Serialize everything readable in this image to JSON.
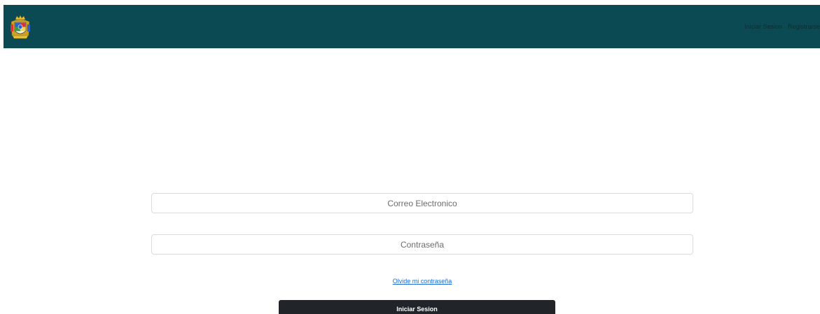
{
  "navbar": {
    "background_color": "#0b4a52",
    "logo_icon": "coat-of-arms-logo",
    "links": [
      {
        "label": "Iniciar Sesion"
      },
      {
        "label": "Registrarse"
      }
    ]
  },
  "form": {
    "email_placeholder": "Correo Electronico",
    "email_value": "",
    "password_placeholder": "Contraseña",
    "password_value": "",
    "forgot_label": "Olvide mi contraseña",
    "submit_label": "Iniciar Sesion"
  },
  "colors": {
    "link": "#1a6cd6",
    "button_bg": "#212529"
  }
}
